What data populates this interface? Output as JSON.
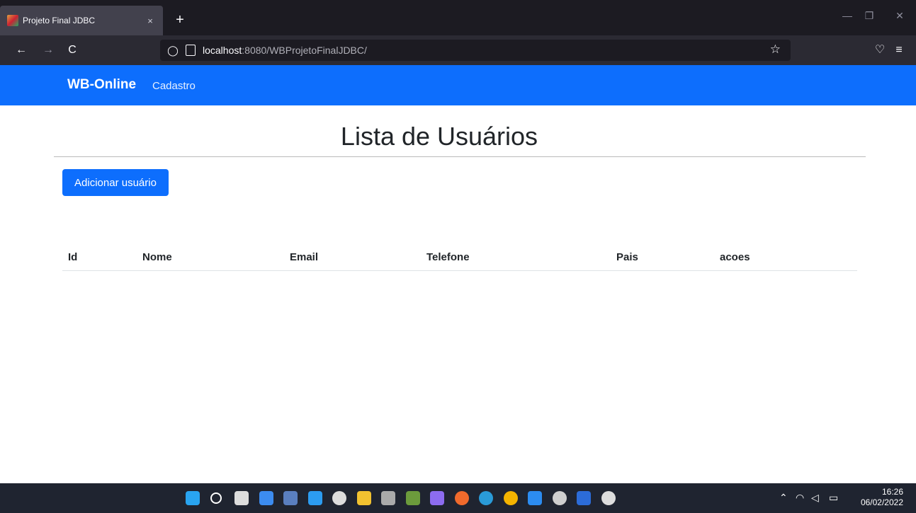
{
  "browser": {
    "tab_title": "Projeto Final JDBC",
    "tab_close": "×",
    "new_tab": "+",
    "url_host": "localhost",
    "url_path": ":8080/WBProjetoFinalJDBC/",
    "back": "←",
    "forward": "→",
    "reload": "C",
    "minimize": "—",
    "restore": "❐",
    "close": "✕",
    "bookmark": "☆",
    "pocket": "♡",
    "menu": "≡"
  },
  "app": {
    "brand": "WB-Online",
    "nav_link": "Cadastro",
    "title": "Lista de Usuários",
    "add_button": "Adicionar usuário",
    "table": {
      "headers": [
        "Id",
        "Nome",
        "Email",
        "Telefone",
        "Pais",
        "acoes"
      ]
    }
  },
  "taskbar": {
    "time": "16:26",
    "date": "06/02/2022",
    "icons": [
      "windows-icon",
      "search-icon",
      "task-view-icon",
      "widgets-icon",
      "sql-icon",
      "vscode-icon",
      "eclipse-icon",
      "explorer-icon",
      "eclipse-ide-icon",
      "notepad-icon",
      "snip-icon",
      "firefox-icon",
      "edge-icon",
      "chrome-icon",
      "mail-icon",
      "settings-icon",
      "sourcetree-icon",
      "app-icon"
    ],
    "icon_colors": [
      "#29a4f0",
      "#fff",
      "#ddd",
      "#3c8cf0",
      "#5a7fbf",
      "#2c9cf0",
      "#ddd",
      "#f2c230",
      "#aaa",
      "#6c9b3c",
      "#8c6cf0",
      "#f06a2c",
      "#2a9bd8",
      "#f4b400",
      "#2c8cf0",
      "#cfcfcf",
      "#2c6cd8",
      "#ddd"
    ]
  }
}
